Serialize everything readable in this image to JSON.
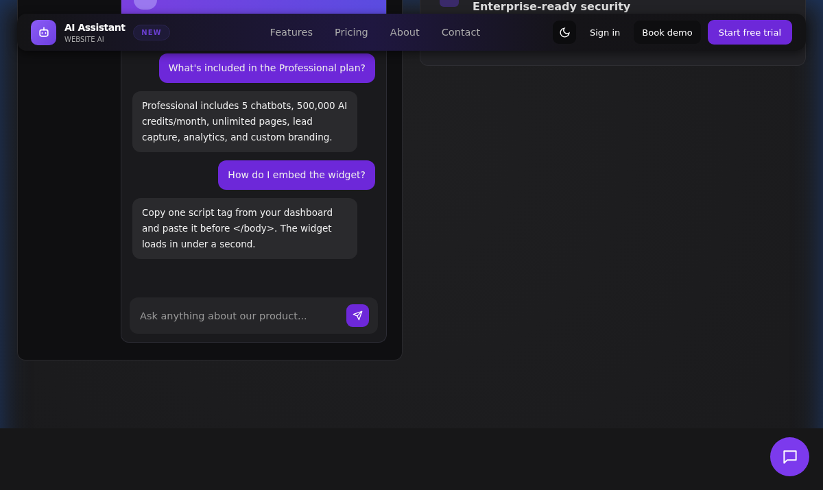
{
  "nav": {
    "logo_title": "AI Assistant",
    "logo_subtitle": "WEBSITE AI",
    "badge": "NEW",
    "links": [
      "Features",
      "Pricing",
      "About",
      "Contact"
    ],
    "sign_in": "Sign in",
    "book_demo": "Book demo",
    "cta": "Start free trial"
  },
  "feature_card": {
    "title": "Enterprise-ready security"
  },
  "chat": {
    "messages": [
      {
        "kind": "user",
        "text": "What's included in the Professional plan?"
      },
      {
        "kind": "bot",
        "text": "Professional includes 5 chatbots, 500,000 AI credits/month, unlimited pages, lead capture, analytics, and custom branding."
      },
      {
        "kind": "user",
        "text": "How do I embed the widget?"
      },
      {
        "kind": "bot",
        "text": "Copy one script tag from your dashboard and paste it before </body>. The widget loads in under a second."
      }
    ],
    "placeholder": "Ask anything about our product..."
  }
}
